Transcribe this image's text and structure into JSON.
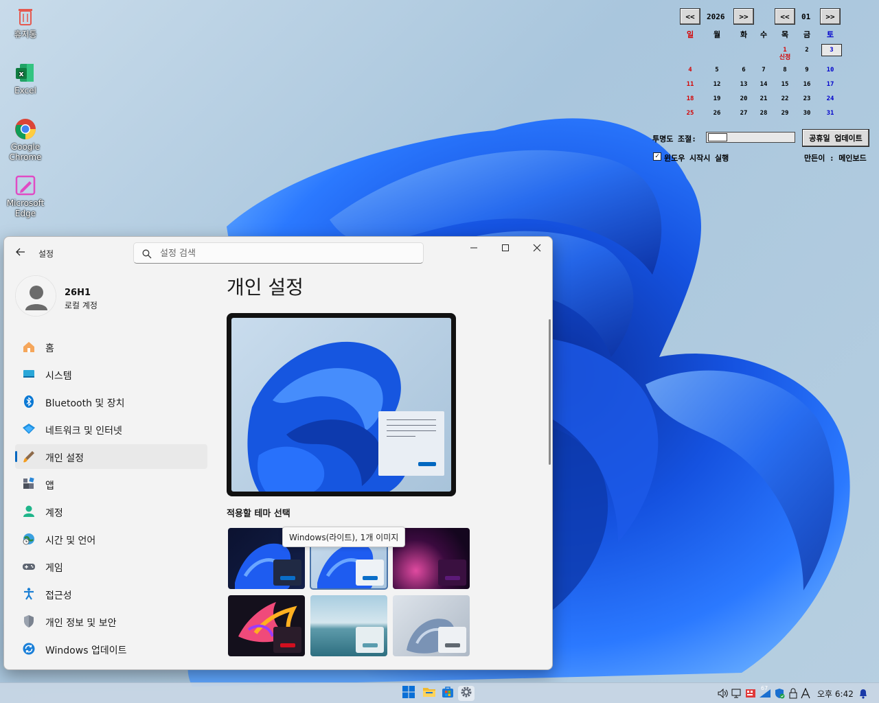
{
  "desktop": {
    "icons": [
      {
        "label": "휴지통",
        "icon": "recycle-bin-icon"
      },
      {
        "label": "Excel",
        "icon": "excel-icon"
      },
      {
        "label": "Google Chrome",
        "icon": "chrome-icon"
      },
      {
        "label": "Microsoft Edge",
        "icon": "edge-icon"
      }
    ]
  },
  "calendar": {
    "prev_year": "<<",
    "year": "2026",
    "next_year": ">>",
    "prev_month": "<<",
    "month": "01",
    "next_month": ">>",
    "weekdays": [
      "일",
      "월",
      "화",
      "수",
      "목",
      "금",
      "토"
    ],
    "holiday_label": "신정",
    "weeks": [
      [
        "",
        "",
        "",
        "",
        "1",
        "2",
        "3"
      ],
      [
        "4",
        "5",
        "6",
        "7",
        "8",
        "9",
        "10"
      ],
      [
        "11",
        "12",
        "13",
        "14",
        "15",
        "16",
        "17"
      ],
      [
        "18",
        "19",
        "20",
        "21",
        "22",
        "23",
        "24"
      ],
      [
        "25",
        "26",
        "27",
        "28",
        "29",
        "30",
        "31"
      ]
    ],
    "today": "3",
    "transparency_label": "투명도 조절:",
    "transparency_value": 0.2,
    "update_button": "공휴일 업데이트",
    "startup_checkbox_label": "윈도우 시작시 실행",
    "startup_checked": true,
    "author": "만든이 : 메인보드",
    "colors": {
      "sunday": "#d40000",
      "saturday": "#0000cc",
      "weekday": "#000000"
    }
  },
  "settings": {
    "title": "설정",
    "search_placeholder": "설정 검색",
    "user_name": "26H1",
    "user_sub": "로컬 계정",
    "nav": [
      {
        "label": "홈",
        "icon": "home-icon"
      },
      {
        "label": "시스템",
        "icon": "system-icon"
      },
      {
        "label": "Bluetooth 및 장치",
        "icon": "bluetooth-icon"
      },
      {
        "label": "네트워크 및 인터넷",
        "icon": "network-icon"
      },
      {
        "label": "개인 설정",
        "icon": "personalization-icon",
        "active": true
      },
      {
        "label": "앱",
        "icon": "apps-icon"
      },
      {
        "label": "계정",
        "icon": "accounts-icon"
      },
      {
        "label": "시간 및 언어",
        "icon": "time-language-icon"
      },
      {
        "label": "게임",
        "icon": "gaming-icon"
      },
      {
        "label": "접근성",
        "icon": "accessibility-icon"
      },
      {
        "label": "개인 정보 및 보안",
        "icon": "privacy-icon"
      },
      {
        "label": "Windows 업데이트",
        "icon": "windows-update-icon"
      }
    ],
    "page_title": "개인 설정",
    "theme_section_label": "적용할 테마 선택",
    "tooltip": "Windows(라이트), 1개 이미지",
    "themes": [
      {
        "name": "windows-dark",
        "accent": "#0a6ec8"
      },
      {
        "name": "windows-light",
        "accent": "#0a6ec8",
        "selected": true
      },
      {
        "name": "glow",
        "accent": "#5c1a78"
      },
      {
        "name": "captured-motion",
        "accent": "#d10f1f"
      },
      {
        "name": "sunrise",
        "accent": "#5a9cae"
      },
      {
        "name": "flow",
        "accent": "#606870"
      }
    ],
    "accent_color": "#0067c0"
  },
  "taskbar": {
    "apps": [
      "start-icon",
      "file-explorer-icon",
      "store-icon",
      "settings-icon"
    ],
    "tray_badge": "67",
    "clock": "오후 6:42"
  }
}
